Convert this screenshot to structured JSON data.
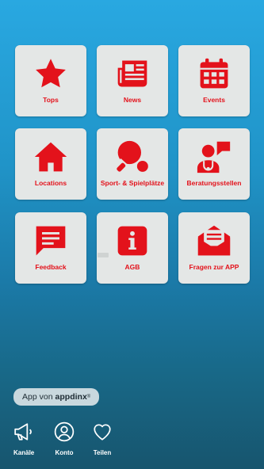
{
  "tiles": [
    {
      "label": "Tops",
      "icon": "star-icon"
    },
    {
      "label": "News",
      "icon": "newspaper-icon"
    },
    {
      "label": "Events",
      "icon": "calendar-icon"
    },
    {
      "label": "Locations",
      "icon": "home-icon"
    },
    {
      "label": "Sport- & Spielplätze",
      "icon": "table-tennis-icon"
    },
    {
      "label": "Beratungsstellen",
      "icon": "doctor-chat-icon"
    },
    {
      "label": "Feedback",
      "icon": "feedback-message-icon"
    },
    {
      "label": "AGB",
      "icon": "info-icon"
    },
    {
      "label": "Fragen zur APP",
      "icon": "mail-envelope-icon"
    }
  ],
  "footer": {
    "prefix": "App von",
    "brand": "appdinx",
    "mark": "®"
  },
  "bottom_nav": [
    {
      "label": "Kanäle",
      "icon": "megaphone-icon"
    },
    {
      "label": "Konto",
      "icon": "user-circle-icon"
    },
    {
      "label": "Teilen",
      "icon": "heart-icon"
    }
  ],
  "colors": {
    "accent": "#e3121b",
    "tile_bg": "#e4e7e6",
    "background_top": "#29a8e1",
    "background_bottom": "#17556e"
  }
}
